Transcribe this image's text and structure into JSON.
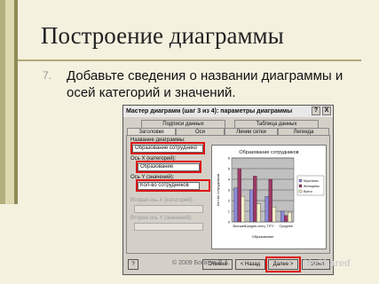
{
  "slide": {
    "title": "Построение диаграммы",
    "bullet_number": "7.",
    "bullet_text": "Добавьте сведения о названии диаграммы и осей категорий и значений.",
    "copyright": "© 2009 Богатов В.А.",
    "watermark": "MyShared"
  },
  "dialog": {
    "title": "Мастер диаграмм (шаг 3 из 4): параметры диаграммы",
    "help_btn": "?",
    "close_btn": "X",
    "tabs_back": [
      "Подписи данных",
      "Таблица данных"
    ],
    "tabs_front": [
      "Заголовки",
      "Оси",
      "Линии сетки",
      "Легенда"
    ],
    "fields": [
      {
        "label": "Название диаграммы:",
        "value": "Образование сотруднико"
      },
      {
        "label": "Ось X (категорий):",
        "value": "Образование"
      },
      {
        "label": "Ось Y (значений):",
        "value": "Кол-во сотрудников"
      }
    ],
    "disabled_fields": [
      {
        "label": "Вторая ось X (категорий):",
        "value": ""
      },
      {
        "label": "Вторая ось Y (значений):",
        "value": ""
      }
    ],
    "buttons": {
      "help": "?",
      "cancel": "Отмена",
      "back": "< Назад",
      "next": "Далее >",
      "finish": "Готово"
    }
  },
  "chart_data": {
    "type": "bar",
    "title": "Образование сотрудников",
    "xlabel": "Образование",
    "ylabel": "Кол-во сотрудников",
    "categories": [
      "Высшее",
      "Средне-спец",
      "ПТУ",
      "Среднее"
    ],
    "ylim": [
      0,
      6
    ],
    "yticks": [
      "0",
      "1",
      "2",
      "3",
      "4",
      "5",
      "6"
    ],
    "series": [
      {
        "name": "Мужчины",
        "values": [
          3.2,
          3.0,
          2.4,
          1.0
        ],
        "color": "#8a8ad8"
      },
      {
        "name": "Женщины",
        "values": [
          5.0,
          4.3,
          4.0,
          0.6
        ],
        "color": "#9b3a66"
      },
      {
        "name": "Всего",
        "values": [
          2.4,
          1.7,
          1.4,
          0.9
        ],
        "color": "#f4f0c8"
      }
    ]
  }
}
